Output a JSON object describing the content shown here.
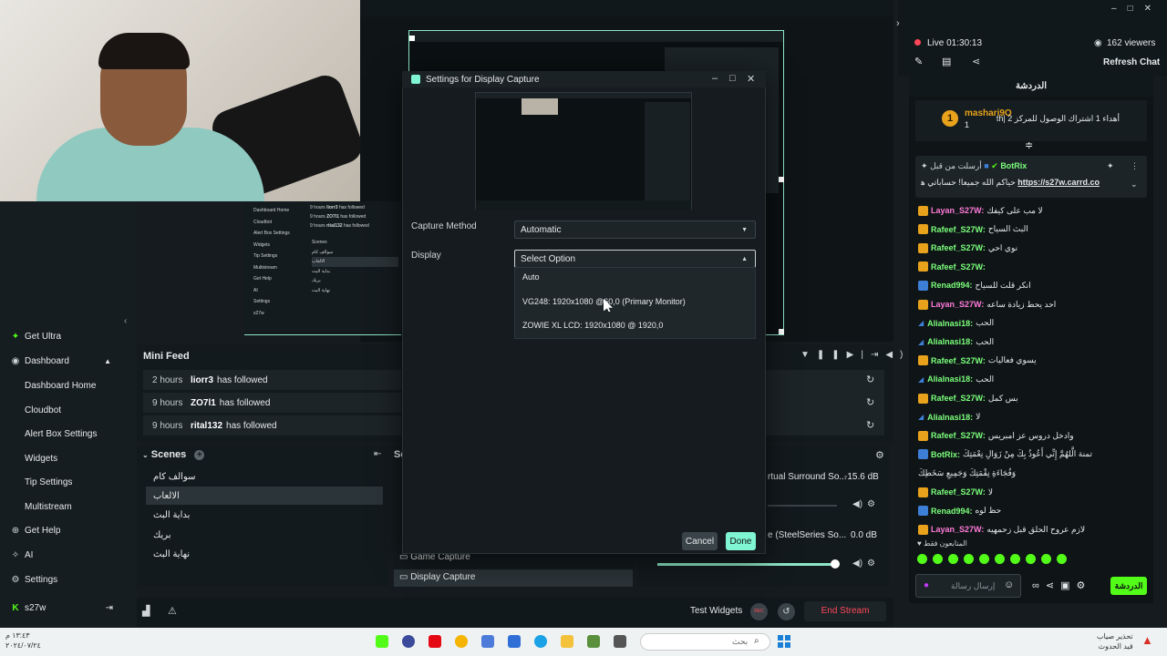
{
  "modal": {
    "title": "Settings for Display Capture",
    "capture_method_label": "Capture Method",
    "capture_method_value": "Automatic",
    "display_label": "Display",
    "display_value": "Select Option",
    "options": [
      "Auto",
      "VG248: 1920x1080 @60,0 (Primary Monitor)",
      "ZOWIE XL LCD: 1920x1080 @ 1920,0"
    ],
    "cancel_label": "Cancel",
    "done_label": "Done"
  },
  "leftnav": {
    "items": [
      {
        "label": "Get Ultra",
        "icon": "star-icon"
      },
      {
        "label": "Dashboard",
        "icon": "palette-icon"
      },
      {
        "label": "Dashboard Home",
        "icon": ""
      },
      {
        "label": "Cloudbot",
        "icon": ""
      },
      {
        "label": "Alert Box Settings",
        "icon": ""
      },
      {
        "label": "Widgets",
        "icon": ""
      },
      {
        "label": "Tip Settings",
        "icon": ""
      },
      {
        "label": "Multistream",
        "icon": ""
      },
      {
        "label": "Get Help",
        "icon": "globe-icon"
      },
      {
        "label": "AI",
        "icon": "sparkle-icon"
      },
      {
        "label": "Settings",
        "icon": "gear-icon"
      },
      {
        "label": "s27w",
        "icon": "kick-icon"
      }
    ]
  },
  "minifeed": {
    "title": "Mini Feed",
    "rows": [
      {
        "time": "2 hours",
        "name": "liorr3",
        "action": "has followed"
      },
      {
        "time": "9 hours",
        "name": "ZO7l1",
        "action": "has followed"
      },
      {
        "time": "9 hours",
        "name": "rital132",
        "action": "has followed"
      }
    ]
  },
  "scenes": {
    "title": "Scenes",
    "items": [
      "سوالف كام",
      "الالعاب",
      "بداية البث",
      "بريك",
      "نهاية البث"
    ]
  },
  "sources": {
    "items": [
      "Game Capture",
      "Display Capture"
    ]
  },
  "mixer": {
    "row1_label": "rtual Surround So...",
    "row1_db": "-15.6 dB",
    "row2_label": "e (SteelSeries So...",
    "row2_db": "0.0 dB"
  },
  "bottombar": {
    "test_widgets": "Test Widgets",
    "rec": "REC",
    "end_stream": "End Stream"
  },
  "stream": {
    "live": "Live 01:30:13",
    "viewers": "162 viewers",
    "refresh_chat": "Refresh Chat",
    "chat_tab": "الدردشة"
  },
  "chat": {
    "sub_user": "mashari9O",
    "sub_count": "1",
    "sub_text": "أهداء 1 اشتراك الوصول للمركز 2 |th",
    "pinned_header": "أرسلت من قبل",
    "pinned_user": "BotRix",
    "pinned_link": "https://s27w.carrd.co",
    "pinned_text": "حياكم الله جميعا! حساباتي هنا",
    "lines": [
      {
        "user": "Layan_S27W:",
        "msg": "لا مب على كيفك",
        "color": "#ff7ad9",
        "badge": "gold"
      },
      {
        "user": "Rafeef_S27W:",
        "msg": "البث السياح",
        "color": "#7bff7b",
        "badge": "gold"
      },
      {
        "user": "Rafeef_S27W:",
        "msg": "نوي احي",
        "color": "#7bff7b",
        "badge": "gold"
      },
      {
        "user": "Rafeef_S27W:",
        "msg": "",
        "color": "#7bff7b",
        "badge": "gold"
      },
      {
        "user": "Renad994:",
        "msg": "انكر قلت للسياح",
        "color": "#7bff7b",
        "badge": "blue"
      },
      {
        "user": "Layan_S27W:",
        "msg": "احد يحط زيادة ساعه",
        "color": "#ff7ad9",
        "badge": "gold"
      },
      {
        "user": "Alialnasi18:",
        "msg": "الحب",
        "color": "#7bff7b",
        "badge": "none"
      },
      {
        "user": "Alialnasi18:",
        "msg": "الحب",
        "color": "#7bff7b",
        "badge": "none"
      },
      {
        "user": "Rafeef_S27W:",
        "msg": "يسوي فعاليات",
        "color": "#7bff7b",
        "badge": "gold"
      },
      {
        "user": "Alialnasi18:",
        "msg": "الحب",
        "color": "#7bff7b",
        "badge": "none"
      },
      {
        "user": "Rafeef_S27W:",
        "msg": "بس كمل",
        "color": "#7bff7b",
        "badge": "gold"
      },
      {
        "user": "Alialnasi18:",
        "msg": "لا",
        "color": "#7bff7b",
        "badge": "none"
      },
      {
        "user": "Rafeef_S27W:",
        "msg": "وادخل دروس عز امبريس",
        "color": "#7bff7b",
        "badge": "gold"
      },
      {
        "user": "BotRix:",
        "msg": "تمنة الَّلهُمَّ إِنِّي أَعُوذُ بِكَ مِنْ زَوَالِ نِعْمَتِكَ",
        "color": "#7bff7b",
        "badge": "blue"
      },
      {
        "user": "",
        "msg": "وَفُجَاءَةِ نِقْمَتِكَ وَجَمِيعِ سَخَطِكَ",
        "color": "#e6e9ea",
        "badge": "none"
      },
      {
        "user": "Rafeef_S27W:",
        "msg": "لا",
        "color": "#7bff7b",
        "badge": "gold"
      },
      {
        "user": "Renad994:",
        "msg": "حظ لوه",
        "color": "#7bff7b",
        "badge": "blue"
      },
      {
        "user": "Layan_S27W:",
        "msg": "لازم عروح الحلق قبل زحمهيه",
        "color": "#ff7ad9",
        "badge": "gold"
      }
    ],
    "followers_only": "المتابعون فقط",
    "input_placeholder": "إرسال رسالة",
    "send_label": "الدردشة"
  },
  "taskbar": {
    "time": "١٣:٤٣ م",
    "date": "٢٠٢٤/٠٧/٢٤",
    "search_placeholder": "بحث",
    "warning_line1": "تحذير صياب",
    "warning_line2": "قيد الحدوث"
  },
  "preview_mini": {
    "rows": [
      {
        "time": "9 hours",
        "name": "liorr3",
        "action": "has followed"
      },
      {
        "time": "9 hours",
        "name": "ZO7l1",
        "action": "has followed"
      },
      {
        "time": "9 hours",
        "name": "rital132",
        "action": "has followed"
      }
    ],
    "nav": [
      "Dashboard Home",
      "Cloudbot",
      "Alert Box Settings",
      "Widgets",
      "Tip Settings",
      "Multistream",
      "Get Help",
      "AI",
      "Settings",
      "s27w"
    ],
    "scenes": [
      "Scenes",
      "سوالف كام",
      "الالعاب",
      "بداية البث",
      "بريك",
      "نهاية البث"
    ]
  },
  "colors": {
    "accent": "#53fc18",
    "end_stream": "#ff4757",
    "done": "#80f5d2",
    "gold_badge": "#e8a21b"
  }
}
